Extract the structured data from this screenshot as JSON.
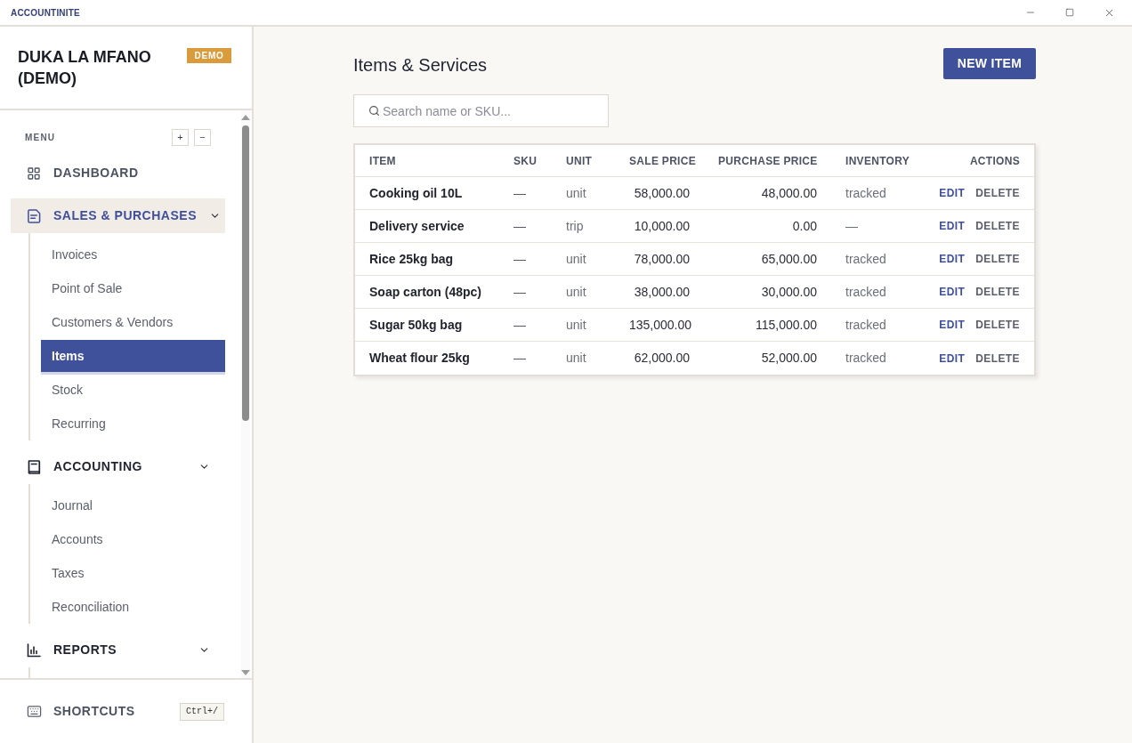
{
  "title_bar": {
    "app_name": "ACCOUNTINITE"
  },
  "sidebar": {
    "company_name": "DUKA LA MFANO (DEMO)",
    "badge": "DEMO",
    "menu_label": "MENU",
    "menu_buttons": [
      "+",
      "−"
    ],
    "nav": [
      {
        "label": "DASHBOARD",
        "kind": "link",
        "selected": false
      },
      {
        "label": "SALES & PURCHASES",
        "kind": "group",
        "selected": true,
        "expanded": true,
        "children": [
          {
            "label": "Invoices",
            "selected": false
          },
          {
            "label": "Point of Sale",
            "selected": false
          },
          {
            "label": "Customers & Vendors",
            "selected": false
          },
          {
            "label": "Items",
            "selected": true
          },
          {
            "label": "Stock",
            "selected": false
          },
          {
            "label": "Recurring",
            "selected": false
          }
        ]
      },
      {
        "label": "ACCOUNTING",
        "kind": "group",
        "selected": false,
        "expanded": true,
        "children": [
          {
            "label": "Journal",
            "selected": false
          },
          {
            "label": "Accounts",
            "selected": false
          },
          {
            "label": "Taxes",
            "selected": false
          },
          {
            "label": "Reconciliation",
            "selected": false
          }
        ]
      },
      {
        "label": "REPORTS",
        "kind": "group",
        "selected": false,
        "expanded": true
      }
    ],
    "footer": {
      "label": "SHORTCUTS",
      "shortcut": "Ctrl+/"
    }
  },
  "main": {
    "title": "Items & Services",
    "new_button": "NEW ITEM",
    "search": {
      "placeholder": "Search name or SKU..."
    },
    "table": {
      "columns": [
        "ITEM",
        "SKU",
        "UNIT",
        "SALE PRICE",
        "PURCHASE PRICE",
        "INVENTORY",
        "ACTIONS"
      ],
      "rows": [
        {
          "item": "Cooking oil 10L",
          "sku": "—",
          "unit": "unit",
          "sale_price": "58,000.00",
          "purchase_price": "48,000.00",
          "inventory": "tracked",
          "actions": [
            {
              "label": "EDIT",
              "kind": "edit"
            },
            {
              "label": "DELETE",
              "kind": "delete"
            }
          ]
        },
        {
          "item": "Delivery service",
          "sku": "—",
          "unit": "trip",
          "sale_price": "10,000.00",
          "purchase_price": "0.00",
          "inventory": "—",
          "actions": [
            {
              "label": "EDIT",
              "kind": "edit"
            },
            {
              "label": "DELETE",
              "kind": "delete"
            }
          ]
        },
        {
          "item": "Rice 25kg bag",
          "sku": "—",
          "unit": "unit",
          "sale_price": "78,000.00",
          "purchase_price": "65,000.00",
          "inventory": "tracked",
          "actions": [
            {
              "label": "EDIT",
              "kind": "edit"
            },
            {
              "label": "DELETE",
              "kind": "delete"
            }
          ]
        },
        {
          "item": "Soap carton (48pc)",
          "sku": "—",
          "unit": "unit",
          "sale_price": "38,000.00",
          "purchase_price": "30,000.00",
          "inventory": "tracked",
          "actions": [
            {
              "label": "EDIT",
              "kind": "edit"
            },
            {
              "label": "DELETE",
              "kind": "delete"
            }
          ]
        },
        {
          "item": "Sugar 50kg bag",
          "sku": "—",
          "unit": "unit",
          "sale_price": "135,000.00",
          "purchase_price": "115,000.00",
          "inventory": "tracked",
          "actions": [
            {
              "label": "EDIT",
              "kind": "edit"
            },
            {
              "label": "DELETE",
              "kind": "delete"
            }
          ]
        },
        {
          "item": "Wheat flour 25kg",
          "sku": "—",
          "unit": "unit",
          "sale_price": "62,000.00",
          "purchase_price": "52,000.00",
          "inventory": "tracked",
          "actions": [
            {
              "label": "EDIT",
              "kind": "edit"
            },
            {
              "label": "DELETE",
              "kind": "delete"
            }
          ]
        }
      ]
    }
  }
}
